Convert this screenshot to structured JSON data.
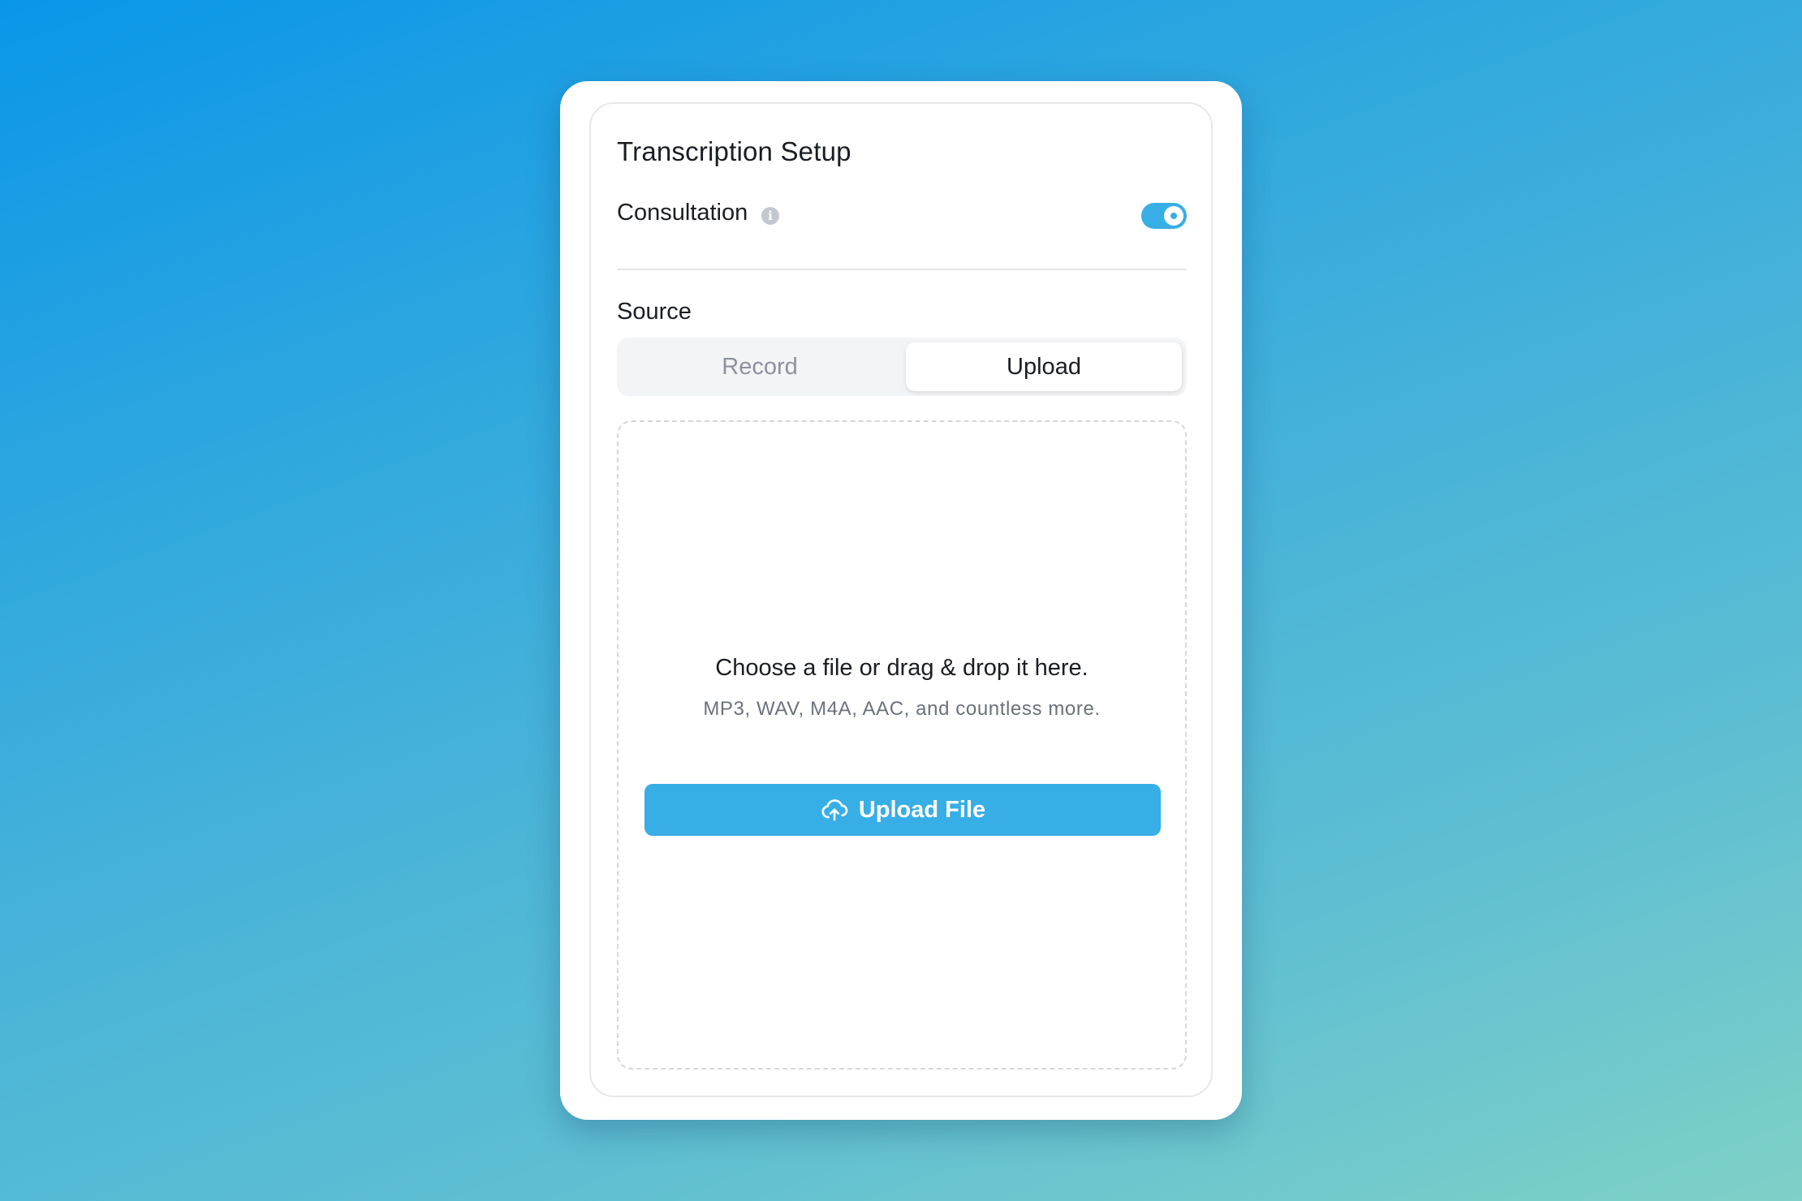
{
  "panel": {
    "title": "Transcription Setup"
  },
  "consultation": {
    "label": "Consultation",
    "info_icon": "info-icon",
    "toggle_on": true
  },
  "source": {
    "label": "Source",
    "options": [
      "Record",
      "Upload"
    ],
    "selected": "Upload"
  },
  "dropzone": {
    "title": "Choose a file or drag & drop it here.",
    "subtitle": "MP3, WAV, M4A, AAC, and countless more.",
    "button_label": "Upload File",
    "button_icon": "cloud-upload-icon"
  },
  "colors": {
    "accent": "#37aee6",
    "text": "#1a1d23",
    "muted": "#8c929c"
  }
}
